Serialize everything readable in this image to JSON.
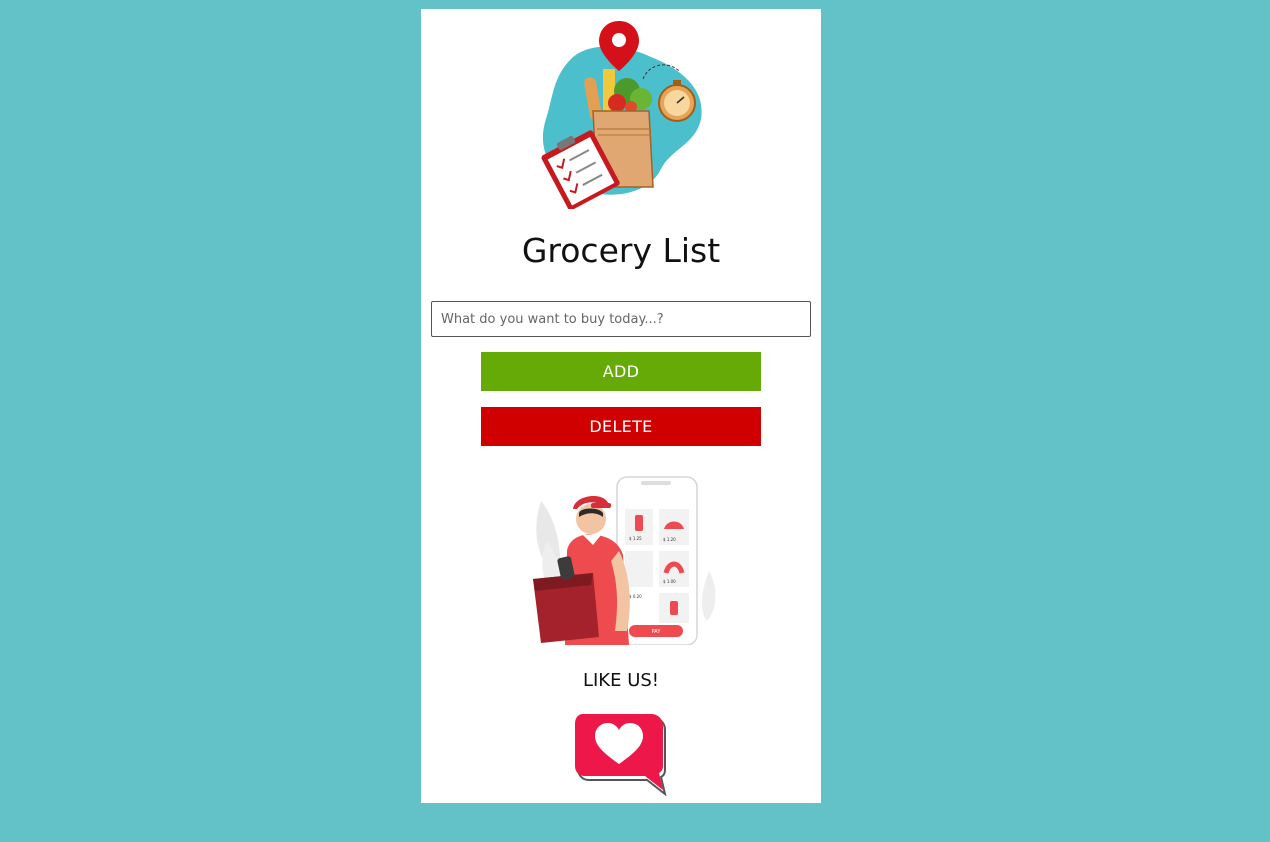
{
  "app": {
    "title": "Grocery List"
  },
  "search": {
    "placeholder": "What do you want to buy today...?",
    "value": ""
  },
  "buttons": {
    "add_label": "ADD",
    "delete_label": "DELETE"
  },
  "like": {
    "label": "LIKE US!"
  },
  "colors": {
    "background": "#63c2c7",
    "card": "#ffffff",
    "add_button": "#66aa08",
    "delete_button": "#d10000",
    "like_icon": "#ee1749"
  },
  "icons": {
    "hero": "grocery-bag-illustration",
    "delivery": "delivery-man-illustration",
    "like": "heart-speech-bubble-icon"
  },
  "delivery_app": {
    "prices": [
      "$ 1.25",
      "$ 1.20",
      "$ 1.00",
      "$ 0.20"
    ],
    "pay_label": "PAY"
  }
}
